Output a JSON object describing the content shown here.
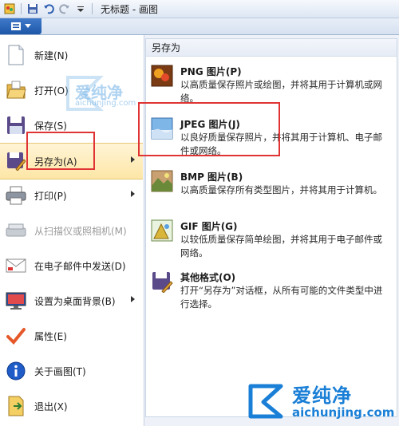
{
  "window": {
    "title": "无标题 - 画图"
  },
  "menu": {
    "items": [
      {
        "label": "新建(N)",
        "icon": "new-document-icon"
      },
      {
        "label": "打开(O)",
        "icon": "open-folder-icon"
      },
      {
        "label": "保存(S)",
        "icon": "save-disk-icon"
      },
      {
        "label": "另存为(A)",
        "icon": "save-as-icon"
      },
      {
        "label": "打印(P)",
        "icon": "printer-icon"
      },
      {
        "label": "从扫描仪或照相机(M)",
        "icon": "scanner-icon"
      },
      {
        "label": "在电子邮件中发送(D)",
        "icon": "email-icon"
      },
      {
        "label": "设置为桌面背景(B)",
        "icon": "desktop-background-icon"
      },
      {
        "label": "属性(E)",
        "icon": "checkmark-icon"
      },
      {
        "label": "关于画图(T)",
        "icon": "info-icon"
      },
      {
        "label": "退出(X)",
        "icon": "exit-icon"
      }
    ]
  },
  "submenu": {
    "header": "另存为",
    "items": [
      {
        "title": "PNG 图片(P)",
        "desc": "以高质量保存照片或绘图，并将其用于计算机或网络。",
        "icon": "png-image-icon"
      },
      {
        "title": "JPEG 图片(J)",
        "desc": "以良好质量保存照片，并将其用于计算机、电子邮件或网络。",
        "icon": "jpeg-image-icon"
      },
      {
        "title": "BMP 图片(B)",
        "desc": "以高质量保存所有类型图片，并将其用于计算机。",
        "icon": "bmp-image-icon"
      },
      {
        "title": "GIF 图片(G)",
        "desc": "以较低质量保存简单绘图，并将其用于电子邮件或网络。",
        "icon": "gif-image-icon"
      },
      {
        "title": "其他格式(O)",
        "desc": "打开“另存为”对话框，从所有可能的文件类型中进行选择。",
        "icon": "other-formats-icon"
      }
    ]
  },
  "watermark": {
    "brand": "爱纯净",
    "url": "aichunjing.com"
  },
  "colors": {
    "accent": "#1e57a8",
    "highlight": "#fde6a6",
    "annotation": "#e03333",
    "watermark": "#1a7fd6"
  }
}
